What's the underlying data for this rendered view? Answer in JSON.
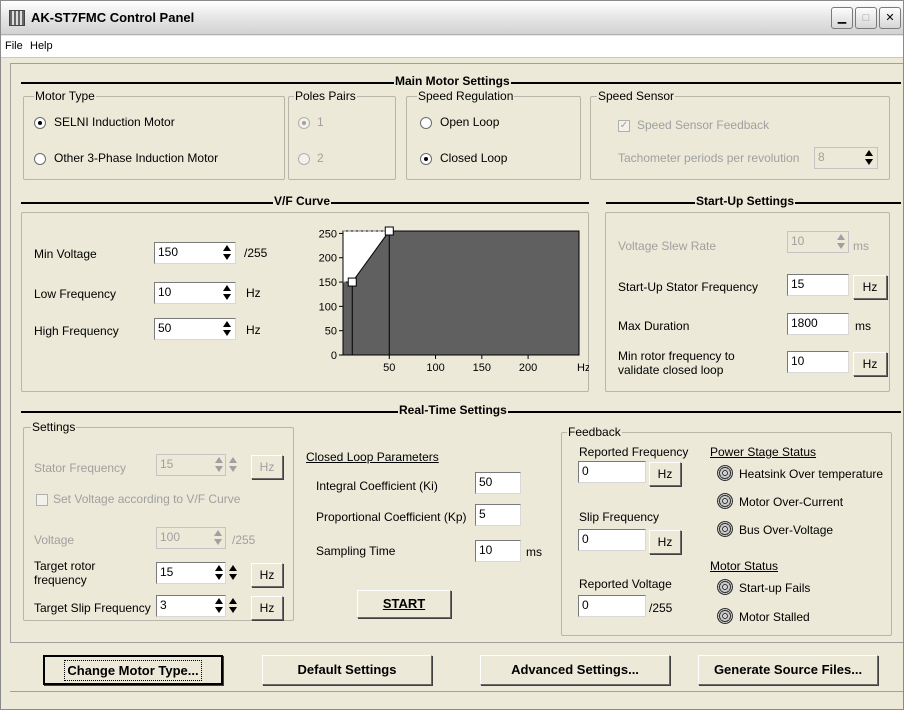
{
  "window": {
    "title": "AK-ST7FMC Control Panel",
    "buttons": [
      "minimize",
      "maximize",
      "close"
    ]
  },
  "menu": {
    "file": "File",
    "help": "Help"
  },
  "main_motor": {
    "title": "Main Motor Settings",
    "motor_type": {
      "label": "Motor Type",
      "options": [
        "SELNI Induction Motor",
        "Other 3-Phase Induction Motor"
      ],
      "selected": "SELNI Induction Motor"
    },
    "poles_pairs": {
      "label": "Poles Pairs",
      "options": [
        "1",
        "2"
      ],
      "selected": "1"
    },
    "speed_regulation": {
      "label": "Speed Regulation",
      "options": [
        "Open Loop",
        "Closed Loop"
      ],
      "selected": "Closed Loop"
    },
    "speed_sensor": {
      "label": "Speed Sensor",
      "feedback_label": "Speed Sensor Feedback",
      "feedback_checked": true,
      "tacho_label": "Tachometer periods per revolution",
      "tacho_value": "8"
    }
  },
  "vf_curve": {
    "title": "V/F Curve",
    "min_voltage_label": "Min Voltage",
    "min_voltage": "150",
    "min_voltage_unit": "/255",
    "low_freq_label": "Low Frequency",
    "low_freq": "10",
    "low_freq_unit": "Hz",
    "high_freq_label": "High Frequency",
    "high_freq": "50",
    "high_freq_unit": "Hz"
  },
  "chart_data": {
    "type": "area",
    "x": [
      0,
      10,
      50,
      255
    ],
    "y": [
      150,
      150,
      255,
      255
    ],
    "xlim": [
      0,
      255
    ],
    "ylim": [
      0,
      255
    ],
    "xticks": [
      50,
      100,
      150,
      200
    ],
    "yticks": [
      0,
      50,
      100,
      150,
      200,
      250
    ],
    "xlabel": "Hz",
    "grid": false,
    "colors": {
      "fill": "#606060",
      "background": "#ffffff",
      "point": "#ffffff"
    }
  },
  "startup": {
    "title": "Start-Up Settings",
    "slew_label": "Voltage Slew Rate",
    "slew_value": "10",
    "slew_unit": "ms",
    "stator_freq_label": "Start-Up Stator Frequency",
    "stator_freq": "15",
    "stator_freq_unit": "Hz",
    "max_duration_label": "Max Duration",
    "max_duration": "1800",
    "max_duration_unit": "ms",
    "min_rotor_label_1": "Min rotor frequency to",
    "min_rotor_label_2": "validate closed loop",
    "min_rotor": "10",
    "min_rotor_unit": "Hz"
  },
  "realtime": {
    "title": "Real-Time Settings",
    "settings": {
      "label": "Settings",
      "stator_freq_label": "Stator Frequency",
      "stator_freq": "15",
      "stator_freq_unit": "Hz",
      "set_voltage_label": "Set Voltage according to V/F Curve",
      "set_voltage_checked": false,
      "voltage_label": "Voltage",
      "voltage": "100",
      "voltage_unit": "/255",
      "target_rotor_label_1": "Target rotor",
      "target_rotor_label_2": "frequency",
      "target_rotor": "15",
      "target_rotor_unit": "Hz",
      "target_slip_label": "Target Slip Frequency",
      "target_slip": "3",
      "target_slip_unit": "Hz"
    },
    "closed_loop": {
      "label": "Closed Loop Parameters",
      "ki_label": "Integral Coefficient (Ki)",
      "ki": "50",
      "kp_label": "Proportional Coefficient (Kp)",
      "kp": "5",
      "sampling_label": "Sampling Time",
      "sampling": "10",
      "sampling_unit": "ms"
    },
    "start_button": "START",
    "feedback": {
      "label": "Feedback",
      "reported_freq_label": "Reported Frequency",
      "reported_freq": "0",
      "reported_freq_unit": "Hz",
      "slip_freq_label": "Slip Frequency",
      "slip_freq": "0",
      "slip_freq_unit": "Hz",
      "reported_voltage_label": "Reported Voltage",
      "reported_voltage": "0",
      "reported_voltage_unit": "/255",
      "power_stage_label": "Power Stage Status",
      "heatsink": "Heatsink Over temperature",
      "over_current": "Motor Over-Current",
      "bus_over_voltage": "Bus Over-Voltage",
      "motor_status_label": "Motor Status",
      "startup_fails": "Start-up Fails",
      "motor_stalled": "Motor Stalled"
    }
  },
  "buttons": {
    "change_motor": "Change Motor Type...",
    "default_settings": "Default Settings",
    "advanced_settings": "Advanced Settings...",
    "generate_source": "Generate Source Files..."
  }
}
